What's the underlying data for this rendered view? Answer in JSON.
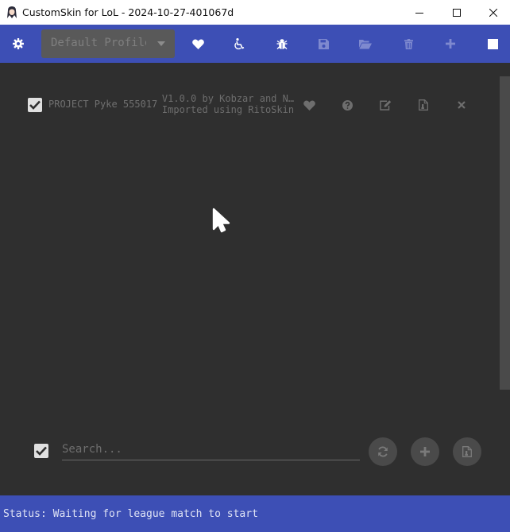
{
  "window": {
    "title": "CustomSkin for LoL - 2024-10-27-401067d",
    "icon": "app-character-icon",
    "controls": [
      "minimize-icon",
      "maximize-icon",
      "close-icon"
    ]
  },
  "toolbar": {
    "settings_icon": "gear-icon",
    "profile": {
      "value": "Default Profile"
    },
    "icons": [
      "heart-icon",
      "accessibility-icon",
      "bug-icon",
      "save-icon",
      "folder-open-icon",
      "trash-icon",
      "plus-icon",
      "stop-icon"
    ]
  },
  "mods": [
    {
      "checked": true,
      "name": "PROJECT Pyke 555017",
      "version_line": "V1.0.0 by Kobzar and N…",
      "description": "Imported using RitoSkin",
      "actions": [
        "heart-icon",
        "help-icon",
        "edit-icon",
        "file-icon",
        "close-icon"
      ]
    }
  ],
  "bottom": {
    "select_all_checked": true,
    "search_placeholder": "Search...",
    "actions": [
      "refresh-icon",
      "add-icon",
      "file-icon"
    ]
  },
  "status": {
    "text": "Status: Waiting for league match to start"
  },
  "colors": {
    "accent": "#3d4fb5",
    "background": "#2f2f2f",
    "panel": "#595959"
  }
}
